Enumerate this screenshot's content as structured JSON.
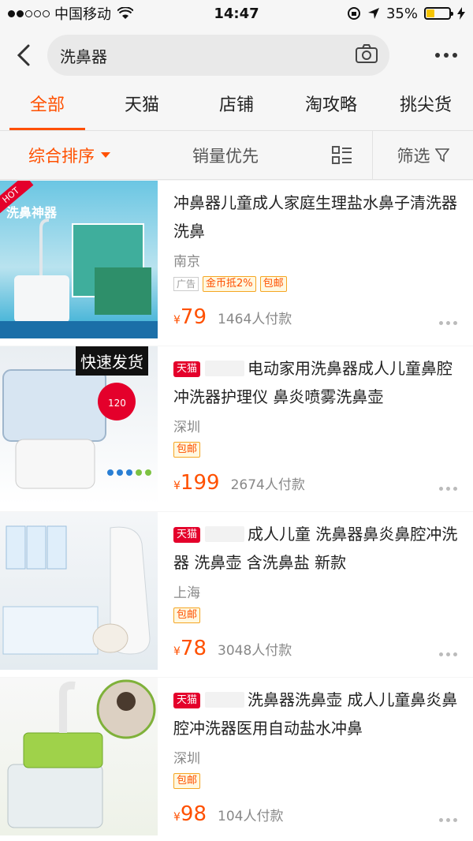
{
  "status_bar": {
    "carrier": "中国移动",
    "time": "14:47",
    "battery_percent": "35%",
    "battery_level": 0.35
  },
  "search": {
    "query": "洗鼻器"
  },
  "tabs": [
    {
      "label": "全部",
      "active": true
    },
    {
      "label": "天猫",
      "active": false
    },
    {
      "label": "店铺",
      "active": false
    },
    {
      "label": "淘攻略",
      "active": false
    },
    {
      "label": "挑尖货",
      "active": false
    }
  ],
  "sort_bar": {
    "sort_label": "综合排序",
    "sales_label": "销量优先",
    "filter_label": "筛选"
  },
  "products": [
    {
      "title": "冲鼻器儿童成人家庭生理盐水鼻子清洗器洗鼻",
      "city": "南京",
      "ad_label": "广告",
      "tags": [
        "金币抵2%",
        "包邮"
      ],
      "currency": "¥",
      "price": "79",
      "sold": "1464人付款",
      "image_text": "洗鼻神器",
      "badge": "HOT"
    },
    {
      "tmall_badge": "天猫",
      "title": "电动家用洗鼻器成人儿童鼻腔冲洗器护理仪 鼻炎喷雾洗鼻壶",
      "city": "深圳",
      "tags": [
        "包邮"
      ],
      "currency": "¥",
      "price": "199",
      "sold": "2674人付款",
      "image_text": "快速发货"
    },
    {
      "tmall_badge": "天猫",
      "title": "成人儿童 洗鼻器鼻炎鼻腔冲洗器 洗鼻壶 含洗鼻盐 新款",
      "city": "上海",
      "tags": [
        "包邮"
      ],
      "currency": "¥",
      "price": "78",
      "sold": "3048人付款"
    },
    {
      "tmall_badge": "天猫",
      "title": "洗鼻器洗鼻壶 成人儿童鼻炎鼻腔冲洗器医用自动盐水冲鼻",
      "city": "深圳",
      "tags": [
        "包邮"
      ],
      "currency": "¥",
      "price": "98",
      "sold": "104人付款"
    }
  ]
}
